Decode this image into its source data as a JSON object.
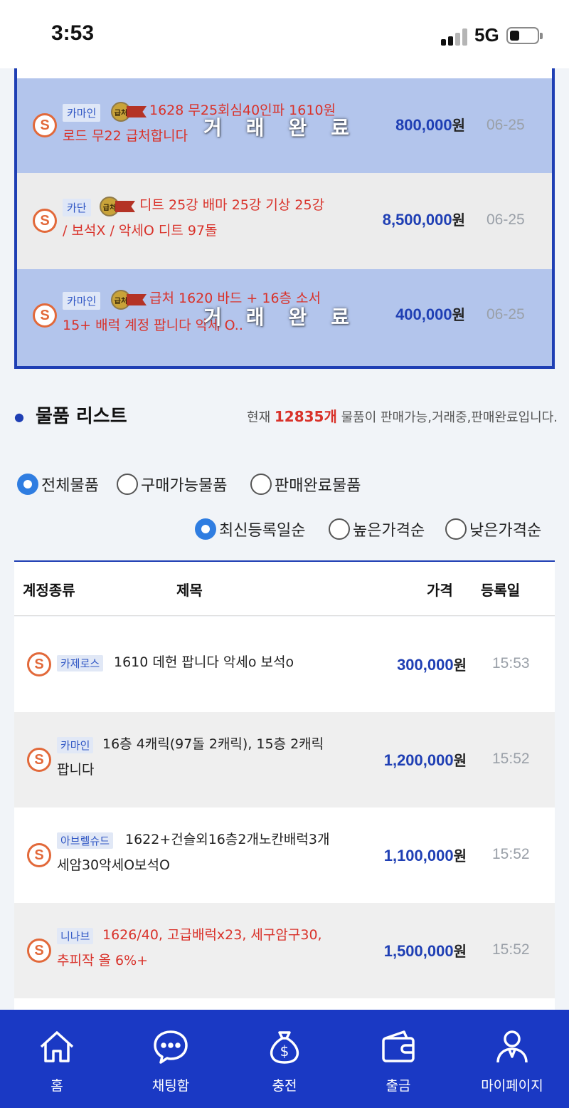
{
  "status_bar": {
    "time": "3:53",
    "network": "5G"
  },
  "featured": [
    {
      "category": "카마인",
      "title_line1": "1628 무25회심40인파 1610원",
      "title_line2": "로드 무22 급처합니다",
      "overlay": "거래완료",
      "price": "800,000",
      "won": "원",
      "date": "06-25",
      "urgent_label": "급처"
    },
    {
      "category": "카단",
      "title_line1": "디트 25강 배마 25강 기상 25강",
      "title_line2": "/ 보석X / 악세O 디트 97돌",
      "price": "8,500,000",
      "won": "원",
      "date": "06-25",
      "urgent_label": "급처"
    },
    {
      "category": "카마인",
      "title_line1": "급처 1620 바드 + 16층 소서",
      "title_line2": "15+ 배럭 계정 팝니다 악세 O..",
      "overlay": "거래완료",
      "price": "400,000",
      "won": "원",
      "date": "06-25",
      "urgent_label": "급처"
    }
  ],
  "list_section": {
    "title": "물품 리스트",
    "count_prefix": "현재 ",
    "count": "12835개",
    "count_suffix": " 물품이 판매가능,거래중,판매완료입니다."
  },
  "filters": {
    "all": "전체물품",
    "available": "구매가능물품",
    "sold": "판매완료물품"
  },
  "sorts": {
    "latest": "최신등록일순",
    "high": "높은가격순",
    "low": "낮은가격순"
  },
  "table": {
    "headers": {
      "type": "계정종류",
      "title": "제목",
      "price": "가격",
      "date": "등록일"
    },
    "rows": [
      {
        "category": "카제로스",
        "title_line1": "1610 데헌 팝니다 악세o 보석o",
        "title_line2": "",
        "price": "300,000",
        "won": "원",
        "date": "15:53"
      },
      {
        "category": "카마인",
        "title_line1": "16층 4캐릭(97돌 2캐릭), 15층 2캐릭",
        "title_line2": "팝니다",
        "price": "1,200,000",
        "won": "원",
        "date": "15:52"
      },
      {
        "category": "아브렐슈드",
        "title_line1": "1622+건슬외16층2개노칸배럭3개",
        "title_line2": "세암30악세O보석O",
        "price": "1,100,000",
        "won": "원",
        "date": "15:52"
      },
      {
        "category": "니나브",
        "title_line1": "1626/40, 고급배럭x23, 세구암구30,",
        "title_line2": "추피작 올 6%+",
        "price": "1,500,000",
        "won": "원",
        "date": "15:52"
      }
    ]
  },
  "nav": {
    "home": "홈",
    "chat": "채팅함",
    "charge": "충전",
    "withdraw": "출금",
    "mypage": "마이페이지"
  },
  "icons": {
    "s_icon": "S",
    "money_bag_symbol": "$"
  }
}
